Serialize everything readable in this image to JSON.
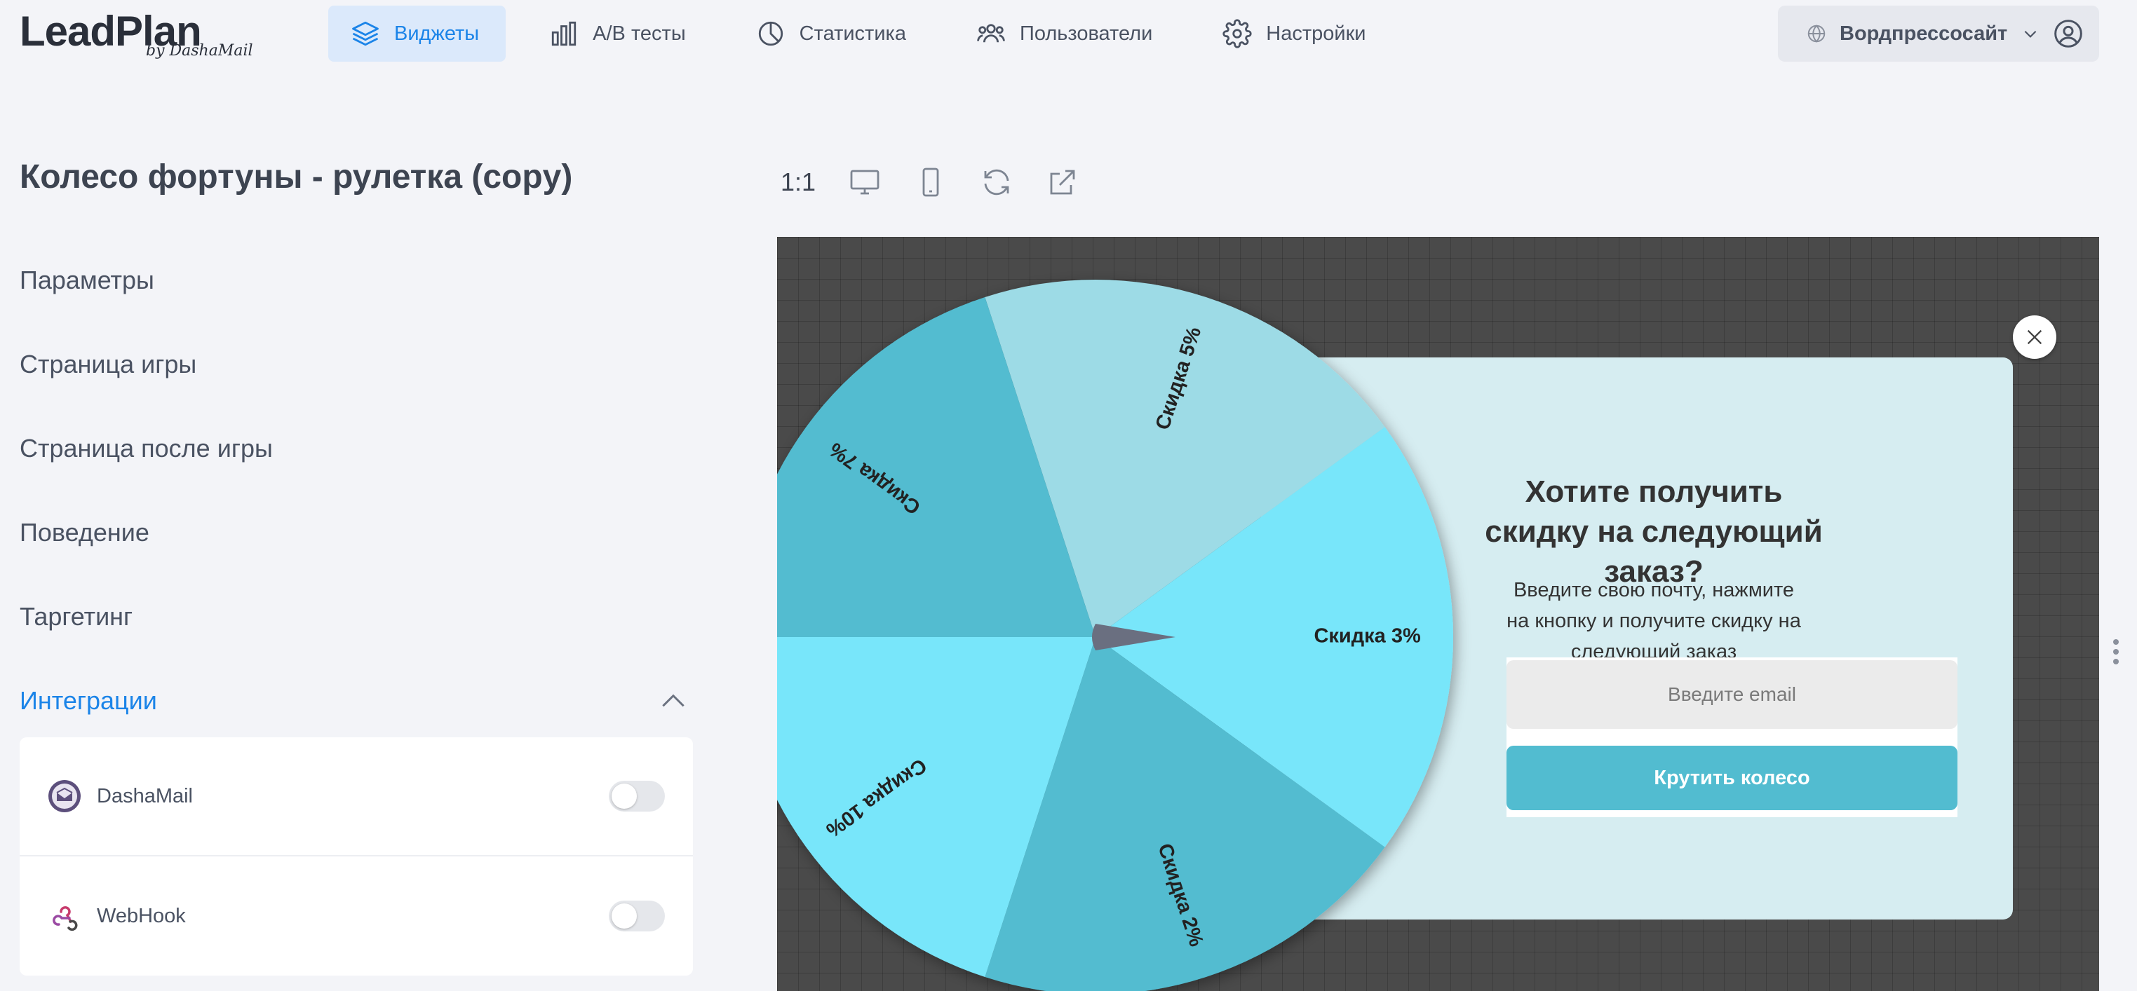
{
  "logo": {
    "main": "LeadPlan",
    "sub": "by DashaMail"
  },
  "nav": [
    {
      "label": "Виджеты",
      "icon": "layers-icon",
      "active": true
    },
    {
      "label": "A/B тесты",
      "icon": "bar-chart-icon",
      "active": false
    },
    {
      "label": "Статистика",
      "icon": "pie-chart-icon",
      "active": false
    },
    {
      "label": "Пользователи",
      "icon": "users-icon",
      "active": false
    },
    {
      "label": "Настройки",
      "icon": "gear-icon",
      "active": false
    }
  ],
  "site": {
    "name": "Вордпрессосайт"
  },
  "page": {
    "title": "Колесо фортуны - рулетка (copy)"
  },
  "sidebar": {
    "items": [
      {
        "label": "Параметры"
      },
      {
        "label": "Страница игры"
      },
      {
        "label": "Страница после игры"
      },
      {
        "label": "Поведение"
      },
      {
        "label": "Таргетинг"
      },
      {
        "label": "Интеграции"
      }
    ],
    "integrations": [
      {
        "label": "DashaMail",
        "enabled": false
      },
      {
        "label": "WebHook",
        "enabled": false
      }
    ]
  },
  "toolbar": {
    "ratio": "1:1"
  },
  "preview": {
    "title": "Хотите получить скидку на следующий заказ?",
    "text": "Введите свою почту, нажмите на кнопку и получите скидку на следующий заказ",
    "email_placeholder": "Введите email",
    "button": "Крутить колесо",
    "wheel": {
      "segments": [
        "Скидка 5%",
        "Скидка 3%",
        "Скидка 2%",
        "Скидка 10%",
        "Скидка 7%"
      ],
      "colors": [
        "#9ddbe6",
        "#78e6fa",
        "#52bcd0",
        "#78e6fa",
        "#52bcd0"
      ]
    }
  },
  "colors": {
    "accent": "#1b84e8",
    "active_bg": "#dbe9fb",
    "button": "#52bcd0"
  }
}
